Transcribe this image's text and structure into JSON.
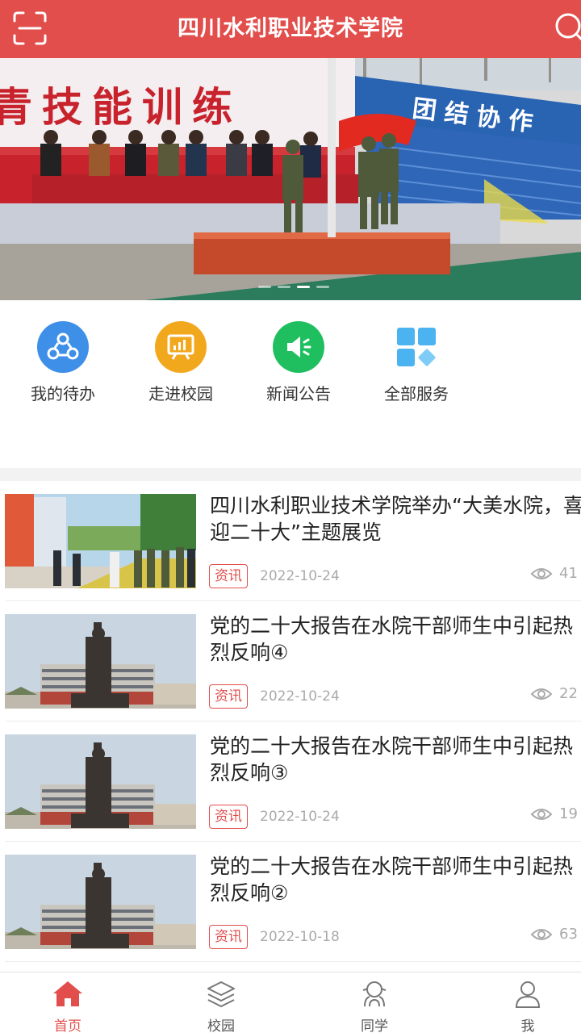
{
  "header": {
    "title": "四川水利职业技术学院",
    "left_icon": "scan-icon",
    "right_icon": "search-icon"
  },
  "banner": {
    "slogan": "青技能训练",
    "board_text": "团结协作",
    "slide_count": 4,
    "active_slide": 3
  },
  "quick_services": [
    {
      "label": "我的待办",
      "icon": "todo-icon",
      "color": "#3d8fe8"
    },
    {
      "label": "走进校园",
      "icon": "campus-board-icon",
      "color": "#f2a81d"
    },
    {
      "label": "新闻公告",
      "icon": "megaphone-icon",
      "color": "#1fbf5f"
    },
    {
      "label": "全部服务",
      "icon": "all-services-grid-icon",
      "color": "#4bb4f0"
    }
  ],
  "news": [
    {
      "title": "四川水利职业技术学院举办“大美水院，喜迎二十大”主题展览",
      "tag": "资讯",
      "date": "2022-10-24",
      "views": "41"
    },
    {
      "title": "党的二十大报告在水院干部师生中引起热烈反响④",
      "tag": "资讯",
      "date": "2022-10-24",
      "views": "22"
    },
    {
      "title": "党的二十大报告在水院干部师生中引起热烈反响③",
      "tag": "资讯",
      "date": "2022-10-24",
      "views": "19"
    },
    {
      "title": "党的二十大报告在水院干部师生中引起热烈反响②",
      "tag": "资讯",
      "date": "2022-10-18",
      "views": "63"
    }
  ],
  "bottom_nav": [
    {
      "label": "首页",
      "icon": "home-icon",
      "active": true
    },
    {
      "label": "校园",
      "icon": "layers-icon",
      "active": false
    },
    {
      "label": "同学",
      "icon": "classmates-icon",
      "active": false
    },
    {
      "label": "我",
      "icon": "person-icon",
      "active": false
    }
  ],
  "colors": {
    "brand": "#e14e4b",
    "text_muted": "#aaaaaa"
  }
}
